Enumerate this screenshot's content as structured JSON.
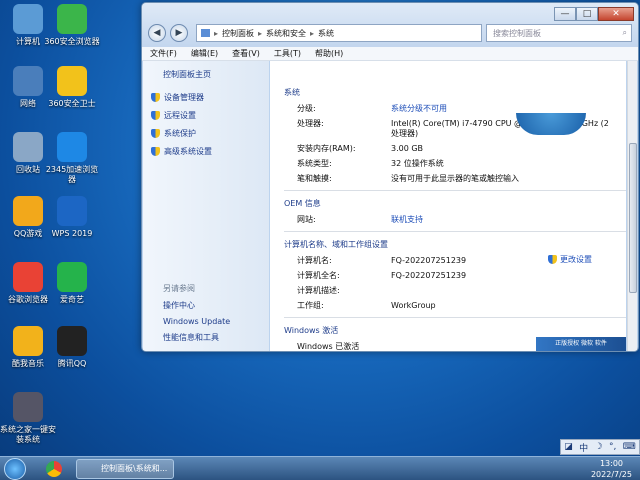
{
  "desktop": {
    "icons": [
      {
        "label": "计算机",
        "color": "#5b9bd5"
      },
      {
        "label": "360安全浏览器",
        "color": "#3bb54a"
      },
      {
        "label": "网络",
        "color": "#4a7ebb"
      },
      {
        "label": "360安全卫士",
        "color": "#f2c21b"
      },
      {
        "label": "回收站",
        "color": "#8aa7c6"
      },
      {
        "label": "2345加速浏览器",
        "color": "#1e88e5"
      },
      {
        "label": "QQ游戏",
        "color": "#f2a81b"
      },
      {
        "label": "WPS 2019",
        "color": "#1c66c4"
      },
      {
        "label": "谷歌浏览器",
        "color": "#e94235"
      },
      {
        "label": "爱奇艺",
        "color": "#25b34b"
      },
      {
        "label": "酷我音乐",
        "color": "#f2b21b"
      },
      {
        "label": "腾讯QQ",
        "color": "#222222"
      },
      {
        "label": "系统之家一键安装系统",
        "color": "#556"
      }
    ]
  },
  "window": {
    "buttons": {
      "minimize": "—",
      "maximize": "□",
      "close": "✕"
    },
    "address": {
      "root": "控制面板",
      "part2": "系统和安全",
      "part3": "系统",
      "sep": "▸"
    },
    "search_placeholder": "搜索控制面板",
    "menu": [
      "文件(F)",
      "编辑(E)",
      "查看(V)",
      "工具(T)",
      "帮助(H)"
    ],
    "left": {
      "home": "控制面板主页",
      "links": [
        "设备管理器",
        "远程设置",
        "系统保护",
        "高级系统设置"
      ],
      "see_also": "另请参阅",
      "sub": [
        "操作中心",
        "Windows Update",
        "性能信息和工具"
      ]
    },
    "system": {
      "title": "系统",
      "rows": [
        {
          "k": "分级:",
          "v": "系统分级不可用",
          "link": true
        },
        {
          "k": "处理器:",
          "v": "Intel(R) Core(TM) i7-4790 CPU @ 3.60GHz   3.60 GHz  (2 处理器)"
        },
        {
          "k": "安装内存(RAM):",
          "v": "3.00 GB"
        },
        {
          "k": "系统类型:",
          "v": "32 位操作系统"
        },
        {
          "k": "笔和触摸:",
          "v": "没有可用于此显示器的笔或触控输入"
        }
      ]
    },
    "oem": {
      "title": "OEM 信息",
      "rows": [
        {
          "k": "网站:",
          "v": "联机支持",
          "link": true
        }
      ]
    },
    "computer": {
      "title": "计算机名称、域和工作组设置",
      "change": "更改设置",
      "rows": [
        {
          "k": "计算机名:",
          "v": "FQ-202207251239"
        },
        {
          "k": "计算机全名:",
          "v": "FQ-202207251239"
        },
        {
          "k": "计算机描述:",
          "v": ""
        },
        {
          "k": "工作组:",
          "v": "WorkGroup"
        }
      ]
    },
    "activation": {
      "title": "Windows 激活",
      "rows": [
        {
          "k": "Windows 已激活",
          "v": ""
        }
      ],
      "badge": "正版授权 微软 软件"
    }
  },
  "ime": [
    "◪",
    "中",
    "☽",
    "°,",
    "⌨"
  ],
  "taskbar": {
    "task_label": "控制面板\\系统和...",
    "time": "13:00",
    "date": "2022/7/25"
  }
}
